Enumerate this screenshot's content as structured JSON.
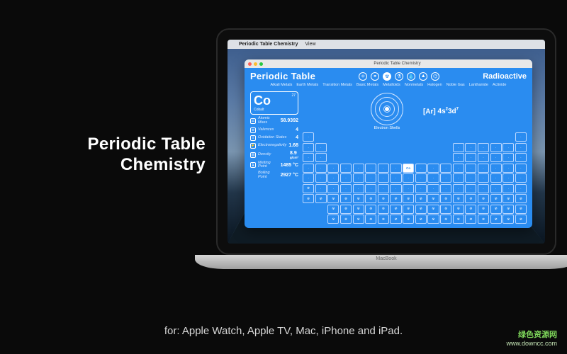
{
  "promo": {
    "title_line1": "Periodic Table",
    "title_line2": "Chemistry",
    "caption": "for: Apple Watch, Apple TV, Mac, iPhone and iPad.",
    "laptop_label": "MacBook"
  },
  "watermark": {
    "cn": "绿色资源网",
    "url": "www.downcc.com"
  },
  "menubar": {
    "app": "Periodic Table Chemistry",
    "menu_view": "View"
  },
  "app": {
    "window_title": "Periodic Table Chemistry",
    "title": "Periodic Table",
    "page_label": "Radioactive",
    "categories": [
      "Alkali Metals",
      "Earth Metals",
      "Transition Metals",
      "Basic Metals",
      "Metalloids",
      "Nonmetals",
      "Halogen",
      "Noble Gas",
      "Lanthanide",
      "Actinide"
    ],
    "electron_shell_label": "Electron Shells",
    "electron_configuration_prefix": "[Ar]",
    "electron_configuration_terms": [
      {
        "n": "4s",
        "sup": "2"
      },
      {
        "n": "3d",
        "sup": "7"
      }
    ],
    "top_icons": [
      "atom",
      "bond",
      "radiation",
      "flask",
      "drop",
      "flame",
      "lab"
    ],
    "element": {
      "number": "27",
      "symbol": "Co",
      "name": "Cobalt"
    },
    "properties": {
      "atomic_mass": {
        "label": "Atomic Mass",
        "value": "58.9392"
      },
      "valences": {
        "label": "Valences",
        "value": "4"
      },
      "oxidation": {
        "label": "Oxidation States",
        "value": "4"
      },
      "electronegativity": {
        "label": "Electronegativity",
        "value": "1.68"
      },
      "density": {
        "label": "Density",
        "value": "8.9",
        "unit": "g/cm³"
      },
      "melting": {
        "label": "Melting Point",
        "value": "1485 °C"
      },
      "boiling": {
        "label": "Boiling Point",
        "value": "2927 °C"
      }
    },
    "grid": {
      "rows": 9,
      "cols": 18,
      "empty": [
        "r1c2",
        "r1c3",
        "r1c4",
        "r1c5",
        "r1c6",
        "r1c7",
        "r1c8",
        "r1c9",
        "r1c10",
        "r1c11",
        "r1c12",
        "r1c13",
        "r1c14",
        "r1c15",
        "r1c16",
        "r1c17",
        "r2c3",
        "r2c4",
        "r2c5",
        "r2c6",
        "r2c7",
        "r2c8",
        "r2c9",
        "r2c10",
        "r2c11",
        "r2c12",
        "r3c3",
        "r3c4",
        "r3c5",
        "r3c6",
        "r3c7",
        "r3c8",
        "r3c9",
        "r3c10",
        "r3c11",
        "r3c12",
        "r8c1",
        "r8c2",
        "r9c1",
        "r9c2"
      ],
      "selected": "r4c9",
      "radioactive": [
        "r6c1",
        "r7c1",
        "r7c2",
        "r7c3",
        "r7c4",
        "r7c5",
        "r7c6",
        "r7c7",
        "r7c8",
        "r7c9",
        "r7c10",
        "r7c11",
        "r7c12",
        "r7c13",
        "r7c14",
        "r7c15",
        "r7c16",
        "r7c17",
        "r7c18",
        "r8c3",
        "r8c14",
        "r9c3",
        "r9c4",
        "r9c5",
        "r9c6",
        "r9c7",
        "r9c8",
        "r9c9",
        "r9c10",
        "r9c11",
        "r9c12",
        "r9c13",
        "r9c14",
        "r9c15",
        "r9c16",
        "r9c17",
        "r9c18",
        "r8c4",
        "r8c5",
        "r8c6",
        "r8c7",
        "r8c8",
        "r8c9",
        "r8c10",
        "r8c11",
        "r8c12",
        "r8c13",
        "r8c15",
        "r8c16",
        "r8c17",
        "r8c18"
      ]
    }
  }
}
